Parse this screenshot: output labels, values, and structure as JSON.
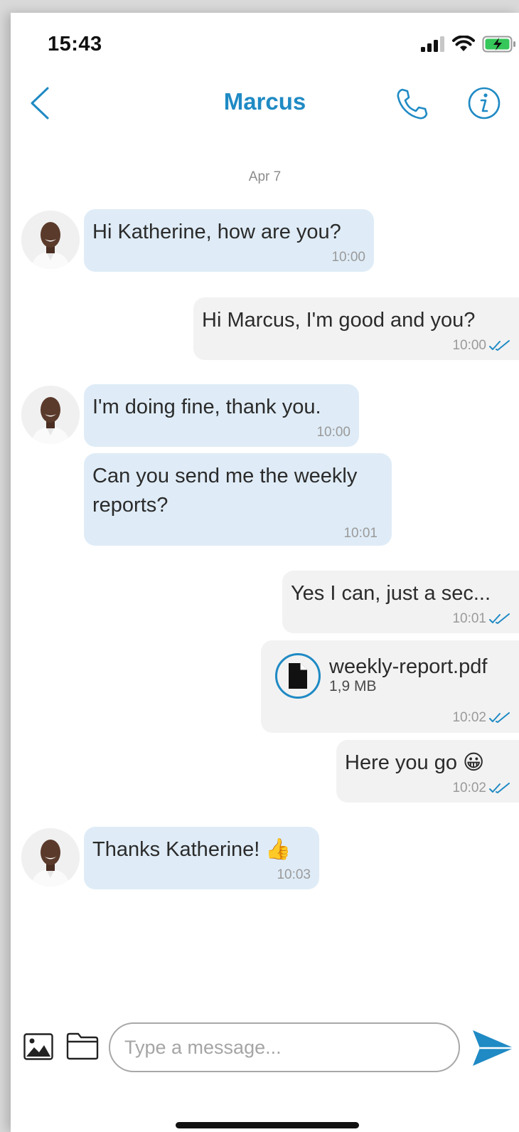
{
  "status_bar": {
    "time": "15:43"
  },
  "header": {
    "title": "Marcus"
  },
  "date_separator": "Apr 7",
  "messages": [
    {
      "text": "Hi Katherine, how are you?",
      "time": "10:00"
    },
    {
      "text": "Hi Marcus, I'm good and you?",
      "time": "10:00"
    },
    {
      "text": "I'm doing fine, thank you.",
      "time": "10:00"
    },
    {
      "text": "Can you send me the weekly reports?",
      "time": "10:01"
    },
    {
      "text": "Yes I can, just a sec...",
      "time": "10:01"
    },
    {
      "file_name": "weekly-report.pdf",
      "file_size": "1,9 MB",
      "time": "10:02"
    },
    {
      "text": "Here you go 😀",
      "time": "10:02"
    },
    {
      "text": "Thanks Katherine! 👍",
      "time": "10:03"
    }
  ],
  "composer": {
    "placeholder": "Type a message..."
  },
  "colors": {
    "accent": "#1f8ac4",
    "incoming_bubble": "#dfecf7",
    "outgoing_bubble": "#f2f2f2"
  },
  "icons": [
    "back-chevron-icon",
    "phone-icon",
    "info-icon",
    "image-icon",
    "folder-icon",
    "send-icon",
    "document-icon",
    "double-check-icon"
  ]
}
